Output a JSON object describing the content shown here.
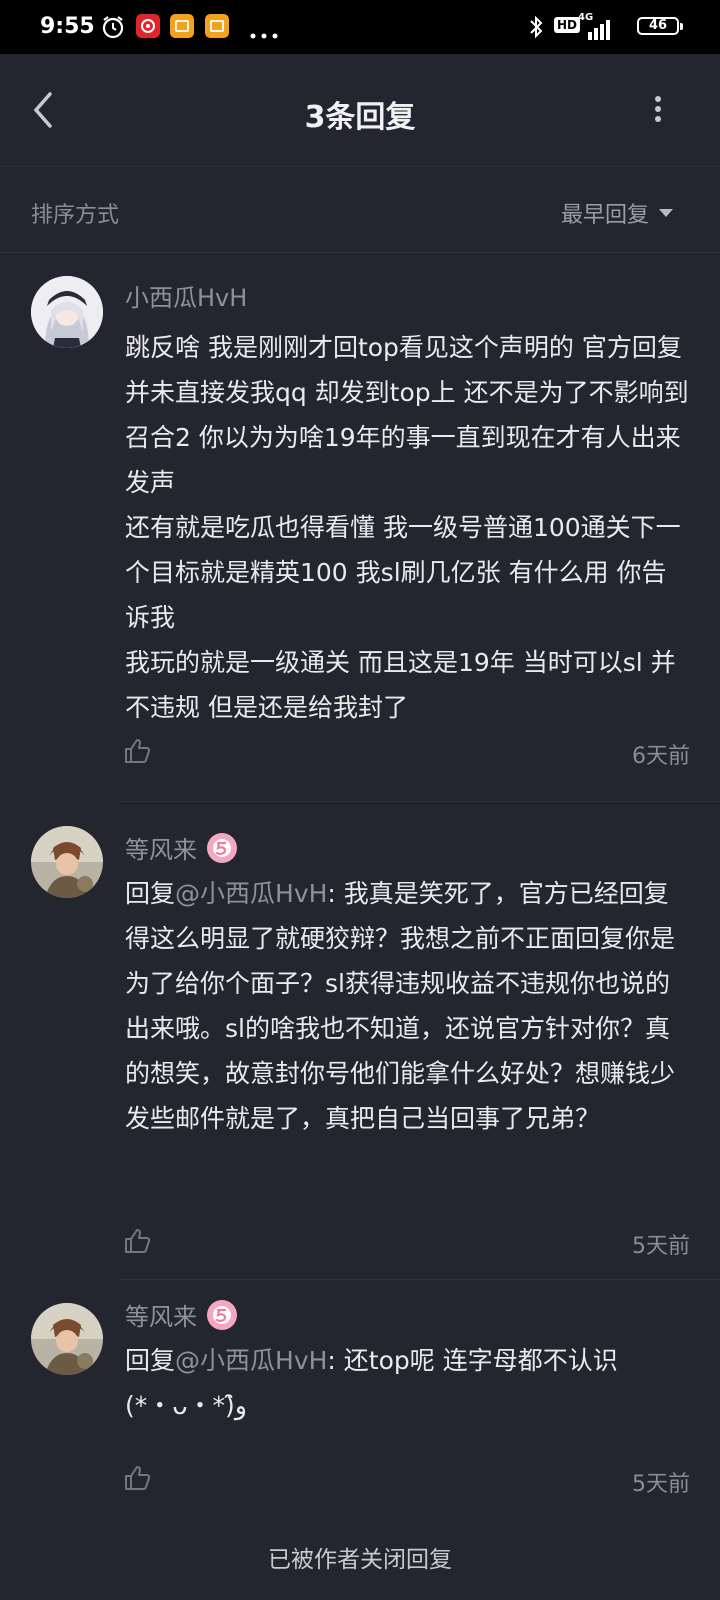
{
  "status_bar": {
    "time": "9:55",
    "battery": "46",
    "network": "4G",
    "hd_label": "HD",
    "icons": [
      "alarm-icon",
      "netease-music-icon",
      "app-icon",
      "app-icon",
      "more-dots-icon",
      "bluetooth-icon",
      "signal-icon",
      "battery-icon"
    ]
  },
  "header": {
    "title": "3条回复",
    "icons": [
      "back-arrow-icon",
      "more-vertical-icon"
    ]
  },
  "sort": {
    "label": "排序方式",
    "selected": "最早回复"
  },
  "comments": [
    {
      "username": "小西瓜HvH",
      "reply_prefix": "",
      "mention": "",
      "text": "跳反啥 我是刚刚才回top看见这个声明的 官方回复 并未直接发我qq 却发到top上 还不是为了不影响到召合2 你以为为啥19年的事一直到现在才有人出来发声\n还有就是吃瓜也得看懂 我一级号普通100通关下一个目标就是精英100 我sl刷几亿张 有什么用 你告诉我\n我玩的就是一级通关 而且这是19年 当时可以sl 并不违规 但是还是给我封了",
      "time": "6天前"
    },
    {
      "username": "等风来",
      "reply_prefix": "回复",
      "mention": "@小西瓜HvH",
      "text": ": 我真是笑死了，官方已经回复得这么明显了就硬狡辩？我想之前不正面回复你是为了给你个面子？sl获得违规收益不违规你也说的出来哦。sl的啥我也不知道，还说官方针对你？真的想笑，故意封你号他们能拿什么好处？想赚钱少发些邮件就是了，真把自己当回事了兄弟？",
      "time": "5天前"
    },
    {
      "username": "等风来",
      "reply_prefix": "回复",
      "mention": "@小西瓜HvH",
      "text": ": 还top呢 连字母都不认识\n(*・ᴗ・*)و̑̑",
      "time": "5天前"
    }
  ],
  "footer": {
    "text": "已被作者关闭回复"
  },
  "colors": {
    "background": "#23252f",
    "status_bar": "#000000",
    "text_primary": "#eaeaec",
    "text_secondary": "#8f9199",
    "badge": "#f5a7c0"
  }
}
